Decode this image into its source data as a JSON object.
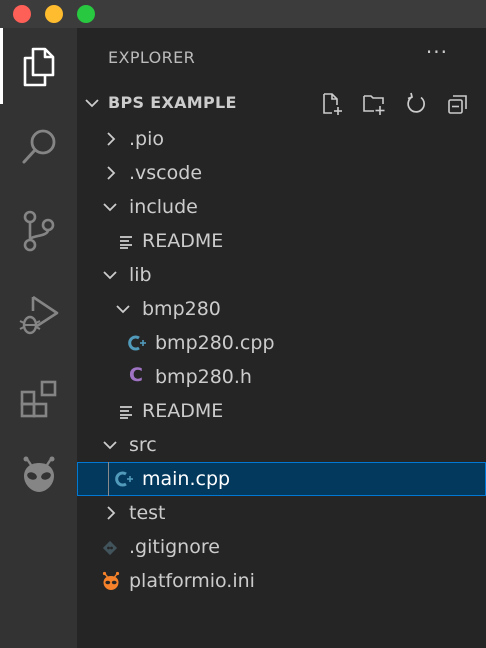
{
  "sidebar": {
    "title": "EXPLORER",
    "more_actions": "···",
    "folder": {
      "title": "BPS EXAMPLE",
      "actions": [
        "new-file-icon",
        "new-folder-icon",
        "refresh-icon",
        "collapse-all-icon"
      ]
    }
  },
  "activity_bar": {
    "items": [
      "explorer-icon",
      "search-icon",
      "source-control-icon",
      "run-debug-icon",
      "extensions-icon",
      "platformio-icon"
    ]
  },
  "tree": [
    {
      "label": ".pio",
      "type": "folder",
      "expanded": false,
      "depth": 0
    },
    {
      "label": ".vscode",
      "type": "folder",
      "expanded": false,
      "depth": 0
    },
    {
      "label": "include",
      "type": "folder",
      "expanded": true,
      "depth": 0
    },
    {
      "label": "README",
      "type": "readme",
      "depth": 1
    },
    {
      "label": "lib",
      "type": "folder",
      "expanded": true,
      "depth": 0
    },
    {
      "label": "bmp280",
      "type": "folder",
      "expanded": true,
      "depth": 1
    },
    {
      "label": "bmp280.cpp",
      "type": "cpp",
      "depth": 2
    },
    {
      "label": "bmp280.h",
      "type": "c-header",
      "depth": 2
    },
    {
      "label": "README",
      "type": "readme",
      "depth": 1
    },
    {
      "label": "src",
      "type": "folder",
      "expanded": true,
      "depth": 0
    },
    {
      "label": "main.cpp",
      "type": "cpp",
      "depth": 1,
      "selected": true
    },
    {
      "label": "test",
      "type": "folder",
      "expanded": false,
      "depth": 0
    },
    {
      "label": ".gitignore",
      "type": "git",
      "depth": 0
    },
    {
      "label": "platformio.ini",
      "type": "platformio",
      "depth": 0
    }
  ],
  "colors": {
    "selection_bg": "#04395e",
    "selection_border": "#0078d4",
    "cpp_icon": "#519aba",
    "c_icon": "#a074c4",
    "platformio_icon": "#f5822a"
  }
}
